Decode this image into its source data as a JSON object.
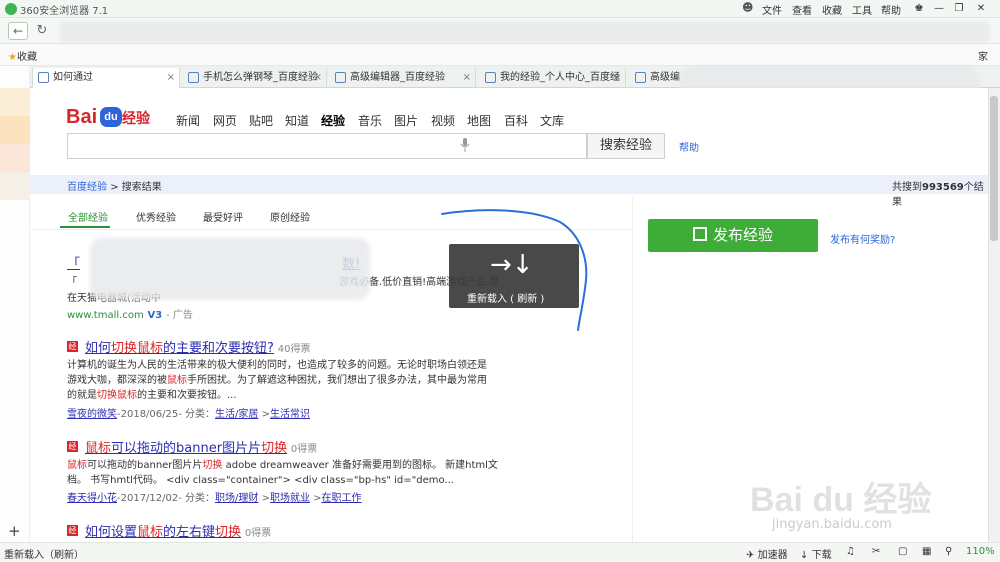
{
  "window": {
    "title": "360安全浏览器 7.1",
    "menus": [
      "文件",
      "查看",
      "收藏",
      "工具",
      "帮助"
    ]
  },
  "favbar": {
    "label": "收藏",
    "right_label": "家"
  },
  "tabs": [
    {
      "label": "如何通过",
      "close": "×"
    },
    {
      "label": "手机怎么弹钢琴_百度经验",
      "close": "×"
    },
    {
      "label": "高级编辑器_百度经验",
      "close": "×"
    },
    {
      "label": "我的经验_个人中心_百度经验",
      "close": "×"
    },
    {
      "label": "高级编",
      "close": ""
    }
  ],
  "logo": {
    "bai": "Bai",
    "du": "du",
    "jy": "经验"
  },
  "topnav": [
    "新闻",
    "网页",
    "贴吧",
    "知道",
    "经验",
    "音乐",
    "图片",
    "视频",
    "地图",
    "百科",
    "文库"
  ],
  "search": {
    "button": "搜索经验",
    "help": "帮助",
    "value": ""
  },
  "breadcrumb": {
    "root": "百度经验",
    "sep": ">",
    "current": "搜索结果"
  },
  "total": {
    "prefix": "共搜到",
    "count": "993569",
    "suffix": "个结果"
  },
  "filters": [
    "全部经验",
    "优秀经验",
    "最受好评",
    "原创经验"
  ],
  "publish": {
    "label": "发布经验",
    "reward": "发布有何奖励?"
  },
  "ad": {
    "title_start": "「",
    "title_end": "数!",
    "line1_start": "「",
    "line1_end": "游戏必备.低价直销!高端游戏产品,尽",
    "line2": "在天猫电器城(活动中",
    "url": "www.tmall.com",
    "v": "V3",
    "tag": "- 广告"
  },
  "results": [
    {
      "title_a": "如何",
      "title_em1": "切换鼠标",
      "title_b": "的主要和次要按钮?",
      "views": "40得票",
      "body": [
        "计算机的诞生为人民的生活带来的极大便利的同时，也造成了较多的问题。无论时职场白领还是",
        "游戏大咖，都深深的被鼠标手所困扰。为了解遮这种困扰，我们想出了很多办法，其中最为常用",
        "的就是切换鼠标的主要和次要按钮。..."
      ],
      "author": "雪夜的微笑",
      "meta": "-2018/06/25- 分类：",
      "cats": [
        "生活/家居",
        "生活常识"
      ]
    },
    {
      "title_em1": "鼠标",
      "title_a": "可以拖动的",
      "title_b": "banner图片片",
      "title_em2": "切换",
      "views": "0得票",
      "body": [
        "鼠标可以拖动的banner图片片切换 adobe dreamweaver 准备好需要用到的图标。 新建html文",
        "档。 书写hmtl代码。 <div class=\"container\"> <div class=\"bp-hs\" id=\"demo..."
      ],
      "author": "春天得小花",
      "meta": "-2017/12/02- 分类：",
      "cats": [
        "职场/理财",
        "职场就业",
        "在职工作"
      ]
    },
    {
      "title_a": "如何设置",
      "title_em1": "鼠标",
      "title_b": "的左右键",
      "title_em2": "切换",
      "views": "0得票"
    }
  ],
  "reload_popup": {
    "arrows": "→↓",
    "label": "重新载入 ( 刷新 )"
  },
  "statusbar": {
    "status": "重新载入（刷新）",
    "accelerator": "加速器",
    "download": "下载",
    "zoom": "110%"
  },
  "watermark": {
    "main": "Bai du 经验",
    "sub": "jingyan.baidu.com"
  },
  "colors": {
    "brand_green": "#3dad38",
    "baidu_red": "#d8262c",
    "baidu_blue": "#2d64d9",
    "link": "#2d2db0"
  }
}
